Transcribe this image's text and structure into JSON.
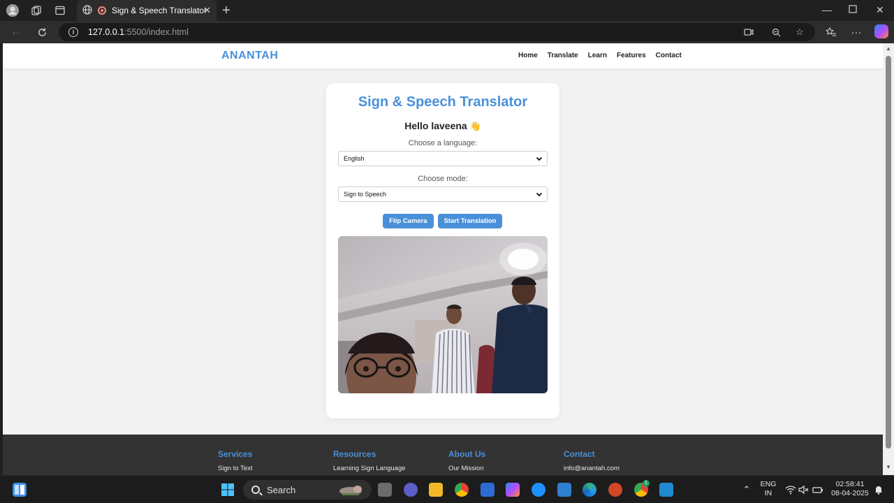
{
  "browser": {
    "tab_title": "Sign & Speech Translator",
    "url_host": "127.0.0.1",
    "url_path": ":5500/index.html"
  },
  "site": {
    "brand": "ANANTAH",
    "nav": [
      "Home",
      "Translate",
      "Learn",
      "Features",
      "Contact"
    ]
  },
  "card": {
    "title": "Sign & Speech Translator",
    "greeting": "Hello laveena",
    "greeting_emoji": "👋",
    "language_label": "Choose a language:",
    "language_value": "English",
    "mode_label": "Choose mode:",
    "mode_value": "Sign to Speech",
    "flip_button": "Flip Camera",
    "start_button": "Start Translation"
  },
  "footer": {
    "columns": [
      {
        "heading": "Services",
        "link": "Sign to Text"
      },
      {
        "heading": "Resources",
        "link": "Learning Sign Language"
      },
      {
        "heading": "About Us",
        "link": "Our Mission"
      },
      {
        "heading": "Contact",
        "link": "info@anantah.com"
      }
    ]
  },
  "taskbar": {
    "search_label": "Search",
    "lang_top": "ENG",
    "lang_bottom": "IN",
    "time": "02:58:41",
    "date": "08-04-2025",
    "badge_count": "1"
  },
  "colors": {
    "accent": "#4a90d9",
    "page_bg": "#f2f2f2",
    "footer_bg": "#333333"
  }
}
